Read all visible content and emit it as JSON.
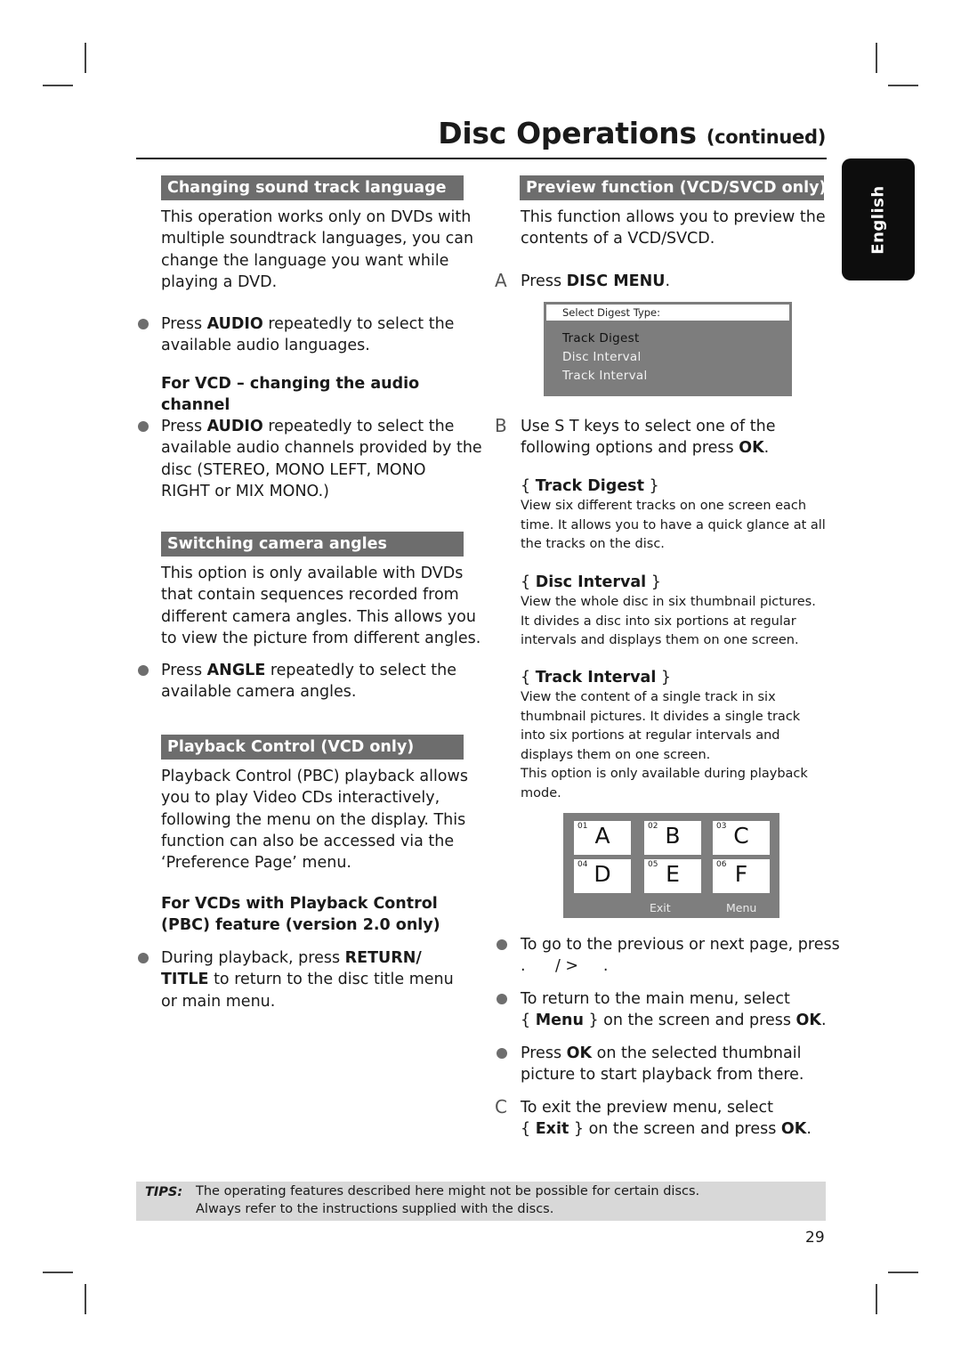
{
  "page": {
    "title": "Disc Operations",
    "title_suffix": "(continued)",
    "language_tab": "English",
    "page_number": "29"
  },
  "left": {
    "sound_track": {
      "header": "Changing sound track language",
      "intro": [
        "This operation works only on DVDs with",
        "multiple soundtrack languages, you can",
        "change the language you want while",
        "playing a DVD."
      ],
      "bullet": {
        "pre": "Press ",
        "key": "AUDIO",
        "post": " repeatedly to select the",
        "line2": "available audio languages."
      },
      "vcd_heading": [
        "For VCD – changing the audio",
        "channel"
      ],
      "vcd_bullet": {
        "pre": "Press ",
        "key": "AUDIO",
        "post": " repeatedly to select the",
        "lines": [
          "available audio channels provided by the",
          "disc (STEREO, MONO LEFT, MONO",
          "RIGHT or MIX MONO.)"
        ]
      }
    },
    "camera": {
      "header": "Switching camera angles",
      "intro": [
        "This option is only available with DVDs",
        "that contain sequences recorded from",
        "different camera angles. This allows you",
        "to view the picture from different angles."
      ],
      "bullet": {
        "pre": "Press ",
        "key": "ANGLE",
        "post": " repeatedly to select the",
        "line2": "available camera angles."
      }
    },
    "pbc": {
      "header": "Playback Control (VCD only)",
      "intro": [
        "Playback Control (PBC) playback allows",
        "you to play Video CDs interactively,",
        "following the menu on the display.  This",
        "function can also be accessed via the",
        "‘Preference Page’ menu."
      ],
      "subheading": [
        "For VCDs with Playback Control",
        "(PBC) feature (version 2.0 only)"
      ],
      "bullet": {
        "pre": "During playback, press ",
        "key1": "RETURN/",
        "key2": "TITLE",
        "post": " to return to the disc title menu",
        "line3": "or main menu."
      }
    }
  },
  "right": {
    "header": "Preview function (VCD/SVCD only)",
    "intro": [
      "This function allows you to preview the",
      "contents of a VCD/SVCD."
    ],
    "step_a": {
      "marker": "A",
      "pre": "Press ",
      "key": "DISC MENU",
      "post": "."
    },
    "osd_menu": {
      "heading": "Select Digest Type:",
      "items": [
        "Track Digest",
        "Disc Interval",
        "Track Interval"
      ],
      "selected_index": 0
    },
    "step_b": {
      "marker": "B",
      "line1": "Use  S T  keys to select one of the",
      "line2_pre": "following options and press ",
      "line2_key": "OK",
      "line2_post": "."
    },
    "options": [
      {
        "name": "Track Digest",
        "desc": [
          "View six different tracks on one screen each",
          "time.  It allows you to have a quick glance at all",
          "the tracks on the disc."
        ]
      },
      {
        "name": "Disc Interval",
        "desc": [
          "View the whole disc in six thumbnail pictures.",
          "It divides a disc into six portions at regular",
          "intervals and displays them on one screen."
        ]
      },
      {
        "name": "Track Interval",
        "desc": [
          "View the content of a single track in six",
          "thumbnail pictures.  It divides a single track",
          "into six portions at regular intervals and",
          "displays them on one screen.",
          "This option is only available during playback",
          "mode."
        ]
      }
    ],
    "thumbnail_grid": {
      "thumbs": [
        {
          "num": "01",
          "letter": "A"
        },
        {
          "num": "02",
          "letter": "B"
        },
        {
          "num": "03",
          "letter": "C"
        },
        {
          "num": "04",
          "letter": "D"
        },
        {
          "num": "05",
          "letter": "E"
        },
        {
          "num": "06",
          "letter": "F"
        }
      ],
      "exit_label": "Exit",
      "menu_label": "Menu"
    },
    "bullets": [
      {
        "line1": "To go to the previous or next page, press",
        "line2": ".      / >     ."
      },
      {
        "line1": "To return to the main menu, select",
        "l2_pre": "{ ",
        "l2_key": "Menu",
        "l2_mid": " } on the screen and press ",
        "l2_key2": "OK",
        "l2_post": "."
      },
      {
        "l1_pre": "Press ",
        "l1_key": "OK",
        "l1_post": " on the selected thumbnail",
        "line2": "picture to start playback from there."
      }
    ],
    "step_c": {
      "marker": "C",
      "line1": "To exit the preview menu, select",
      "l2_pre": "{ ",
      "l2_key": "Exit",
      "l2_mid": " } on the screen and press ",
      "l2_key2": "OK",
      "l2_post": "."
    }
  },
  "tips": {
    "label": "TIPS:",
    "lines": [
      "The operating features described here might not be possible for certain discs.",
      "Always refer to the instructions supplied with the discs."
    ]
  }
}
